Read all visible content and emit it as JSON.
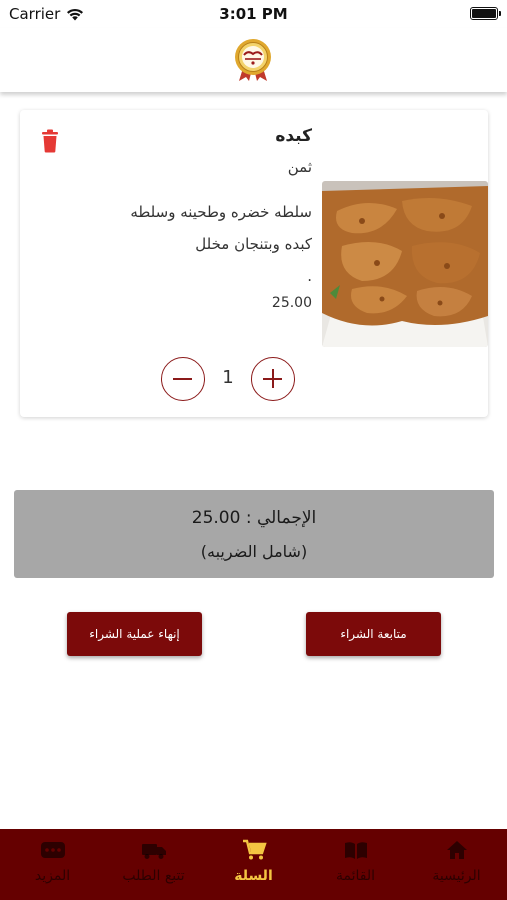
{
  "status_bar": {
    "carrier": "Carrier",
    "time": "3:01 PM"
  },
  "header": {
    "logo_icon": "restaurant-logo-icon"
  },
  "cart_item": {
    "name": "كبده",
    "price_label": "ثمن",
    "description_line1": "سلطه خضره وطحينه وسلطه",
    "description_line2": "كبده وبتنجان مخلل",
    "description_line3": ".",
    "price": "25.00",
    "quantity": "1",
    "image_icon": "fried-liver-photo",
    "delete_icon": "trash-icon"
  },
  "summary": {
    "total": "الإجمالي : 25.00",
    "tax_note": "(شامل الضريبه)"
  },
  "actions": {
    "finish_label": "إنهاء عملية الشراء",
    "continue_label": "متابعة الشراء"
  },
  "tabbar": {
    "items": [
      {
        "label": "الرئيسية",
        "icon": "home-icon"
      },
      {
        "label": "القائمة",
        "icon": "menu-book-icon"
      },
      {
        "label": "السلة",
        "icon": "cart-icon"
      },
      {
        "label": "تتبع الطلب",
        "icon": "delivery-truck-icon"
      },
      {
        "label": "المزيد",
        "icon": "more-icon"
      }
    ],
    "active_index": 2
  },
  "colors": {
    "brand": "#650000",
    "button": "#7c0a0a",
    "accent": "#f4c542",
    "delete": "#e53935",
    "summary_bg": "#a7a7a7"
  }
}
